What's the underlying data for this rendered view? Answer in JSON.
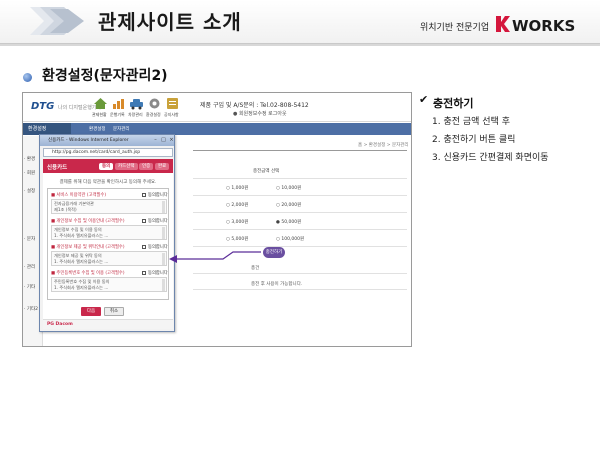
{
  "header": {
    "title": "관제사이트 소개",
    "tagline": "위치기반 전문기업",
    "logo_text": "KWORKS",
    "logo_accent": "#d4163c"
  },
  "section": {
    "title": "환경설정(문자관리2)"
  },
  "steps": {
    "check_icon": "check-icon",
    "heading": "충전하기",
    "items": [
      "1. 충전 금액 선택 후",
      "2. 충전하기 버튼 클릭",
      "3. 신용카드 간편결제 화면이동"
    ]
  },
  "website": {
    "logo": "DTG",
    "logo_sub": "나의 디지털운행기록",
    "toolbar": [
      {
        "icon": "home-icon",
        "label": "관제현황"
      },
      {
        "icon": "chart-icon",
        "label": "운행기록"
      },
      {
        "icon": "car-icon",
        "label": "차량관리"
      },
      {
        "icon": "settings-icon",
        "label": "환경설정"
      },
      {
        "icon": "notice-icon",
        "label": "공지사항"
      }
    ],
    "contact": "제품 구입 및 A/S문의 : Tel.02-808-5412",
    "contact_sub": "● 회원정보수정 로그아웃",
    "nav_current": "환경설정",
    "breadcrumb": [
      "환경설정",
      "문자관리"
    ],
    "side_items": [
      "· 환경",
      "· 회원",
      "· 설정",
      "· 문자",
      "· 관리",
      "· 기타",
      "· 기타2"
    ],
    "path": "홈 > 환경설정 > 문자관리",
    "table_header": "충전금액 선택",
    "radio_options": [
      [
        "○ 1,000원",
        "○ 10,000원"
      ],
      [
        "○ 2,000원",
        "○ 20,000원"
      ],
      [
        "○ 3,000원",
        "● 50,000원"
      ],
      [
        "○ 5,000원",
        "○ 100,000원"
      ]
    ],
    "charge_button": "충전하기",
    "note_1": "총건",
    "note_2": "충전 후 사용이 가능합니다."
  },
  "popup": {
    "window_title": "신용카드 - Windows Internet Explorer",
    "url": "http://pg.dacom.net/card/card_auth.jsp",
    "brand": "신용카드",
    "tabs": [
      "동의",
      "카드선택",
      "인증",
      "완료"
    ],
    "intro": "결제를 위해 다음 약관을 확인하시고 동의해 주세요.",
    "sections": [
      {
        "title": "■ 서비스 이용약관 (고객필수)",
        "agree": "동의합니다",
        "lines": [
          "전자금융거래 기본약관",
          "제1조 (목적)"
        ]
      },
      {
        "title": "■ 개인정보 수집 및 이용안내 (고객필수)",
        "agree": "동의합니다",
        "lines": [
          "개인정보 수집 및 이용 동의",
          "1. 주식회사 엘지유플러스는 ..."
        ]
      },
      {
        "title": "■ 개인정보 제공 및 위탁안내 (고객필수)",
        "agree": "동의합니다",
        "lines": [
          "개인정보 제공 및 위탁 동의",
          "1. 주식회사 엘지유플러스는 ..."
        ]
      },
      {
        "title": "■ 주민등록번호 수집 및 이용 (고객필수)",
        "agree": "동의합니다",
        "lines": [
          "주민등록번호 수집 및 이용 동의",
          "1. 주식회사 엘지유플러스는 ..."
        ]
      }
    ],
    "ok_button": "다음",
    "cancel_button": "취소",
    "footer": "PG Dacom"
  },
  "colors": {
    "popup_accent": "#c9284b",
    "highlight": "#5b2d99",
    "nav": "#4d6fa5"
  }
}
